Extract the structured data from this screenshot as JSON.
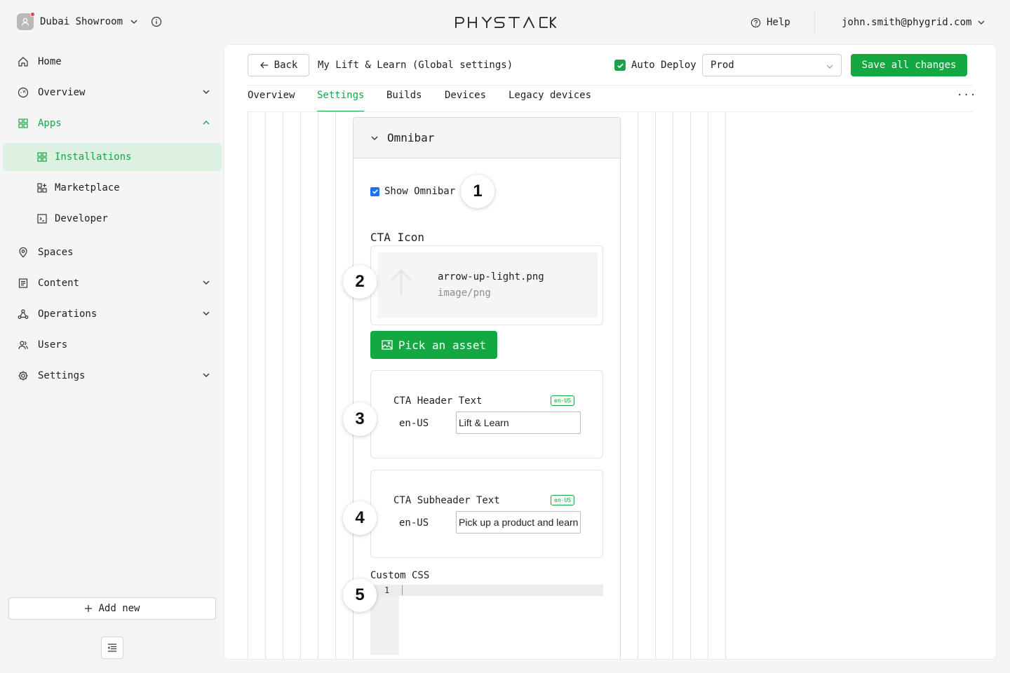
{
  "workspace": {
    "name": "Dubai Showroom"
  },
  "brand": {
    "logo_text": "PHYSTACK"
  },
  "topbar": {
    "help_label": "Help",
    "user_email": "john.smith@phygrid.com"
  },
  "sidebar": {
    "items": [
      {
        "label": "Home",
        "icon": "home-icon"
      },
      {
        "label": "Overview",
        "icon": "gauge-icon"
      },
      {
        "label": "Apps",
        "icon": "grid-icon"
      },
      {
        "label": "Spaces",
        "icon": "map-pin-icon"
      },
      {
        "label": "Content",
        "icon": "document-icon"
      },
      {
        "label": "Operations",
        "icon": "network-icon"
      },
      {
        "label": "Users",
        "icon": "users-icon"
      },
      {
        "label": "Settings",
        "icon": "gear-icon"
      }
    ],
    "sub_items": [
      {
        "label": "Installations",
        "icon": "grid-icon"
      },
      {
        "label": "Marketplace",
        "icon": "grid-plus-icon"
      },
      {
        "label": "Developer",
        "icon": "terminal-icon"
      }
    ],
    "add_new_label": "Add new"
  },
  "header": {
    "back_label": "Back",
    "title": "My Lift & Learn (Global settings)",
    "auto_deploy_label": "Auto Deploy",
    "auto_deploy_checked": true,
    "environment": "Prod",
    "save_label": "Save all changes"
  },
  "tabs": [
    {
      "label": "Overview"
    },
    {
      "label": "Settings",
      "active": true
    },
    {
      "label": "Builds"
    },
    {
      "label": "Devices"
    },
    {
      "label": "Legacy devices"
    }
  ],
  "more_label": "···",
  "panel": {
    "title": "Omnibar",
    "show_omnibar_label": "Show Omnibar",
    "show_omnibar_checked": true,
    "cta_icon_label": "CTA Icon",
    "asset": {
      "filename": "arrow-up-light.png",
      "mime": "image/png"
    },
    "pick_asset_label": "Pick an asset",
    "cta_header": {
      "title": "CTA Header Text",
      "locale_badge": "en-US",
      "locale": "en-US",
      "value": "Lift & Learn"
    },
    "cta_subheader": {
      "title": "CTA Subheader Text",
      "locale_badge": "en-US",
      "locale": "en-US",
      "value": "Pick up a product and learn"
    },
    "custom_css_label": "Custom CSS",
    "code_line_number": "1"
  },
  "annotations": [
    "1",
    "2",
    "3",
    "4",
    "5"
  ],
  "colors": {
    "accent": "#14a843",
    "active_bg": "#dcf1df",
    "checkbox_blue": "#1a73e8"
  }
}
